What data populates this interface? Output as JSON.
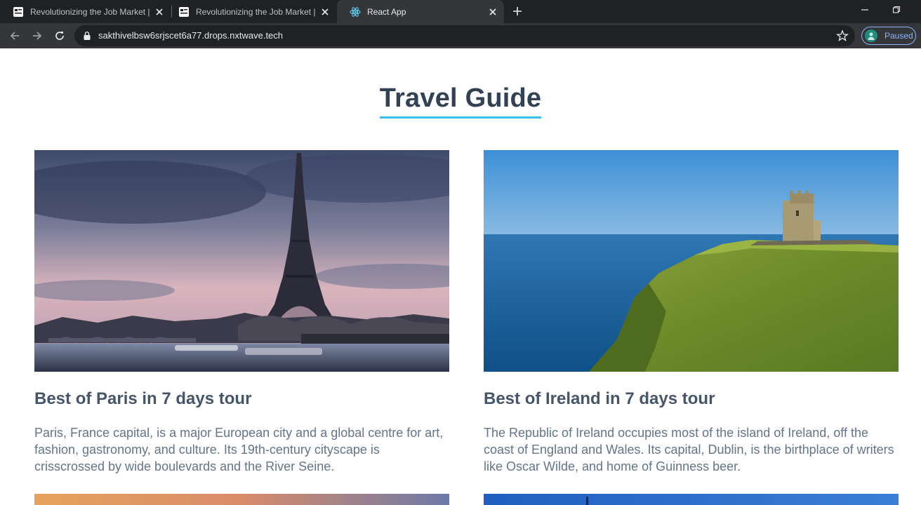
{
  "browser": {
    "tabs": [
      {
        "title": "Revolutionizing the Job Market |",
        "active": false
      },
      {
        "title": "Revolutionizing the Job Market |",
        "active": false
      },
      {
        "title": "React App",
        "active": true
      }
    ],
    "url": "sakthivelbsw6srjscet6a77.drops.nxtwave.tech",
    "profile_status": "Paused",
    "accent_color": "#8ab4f8"
  },
  "page": {
    "heading": "Travel Guide",
    "heading_color": "#334155",
    "underline_color": "#38bdf8",
    "cards": [
      {
        "image_alt": "eiffel-tower-image",
        "title": "Best of Paris in 7 days tour",
        "description": "Paris, France capital, is a major European city and a global centre for art, fashion, gastronomy, and culture. Its 19th-century cityscape is crisscrossed by wide boulevards and the River Seine."
      },
      {
        "image_alt": "cliffs-of-moher-image",
        "title": "Best of Ireland in 7 days tour",
        "description": "The Republic of Ireland occupies most of the island of Ireland, off the coast of England and Wales. Its capital, Dublin, is the birthplace of writers like Oscar Wilde, and home of Guinness beer."
      }
    ]
  }
}
